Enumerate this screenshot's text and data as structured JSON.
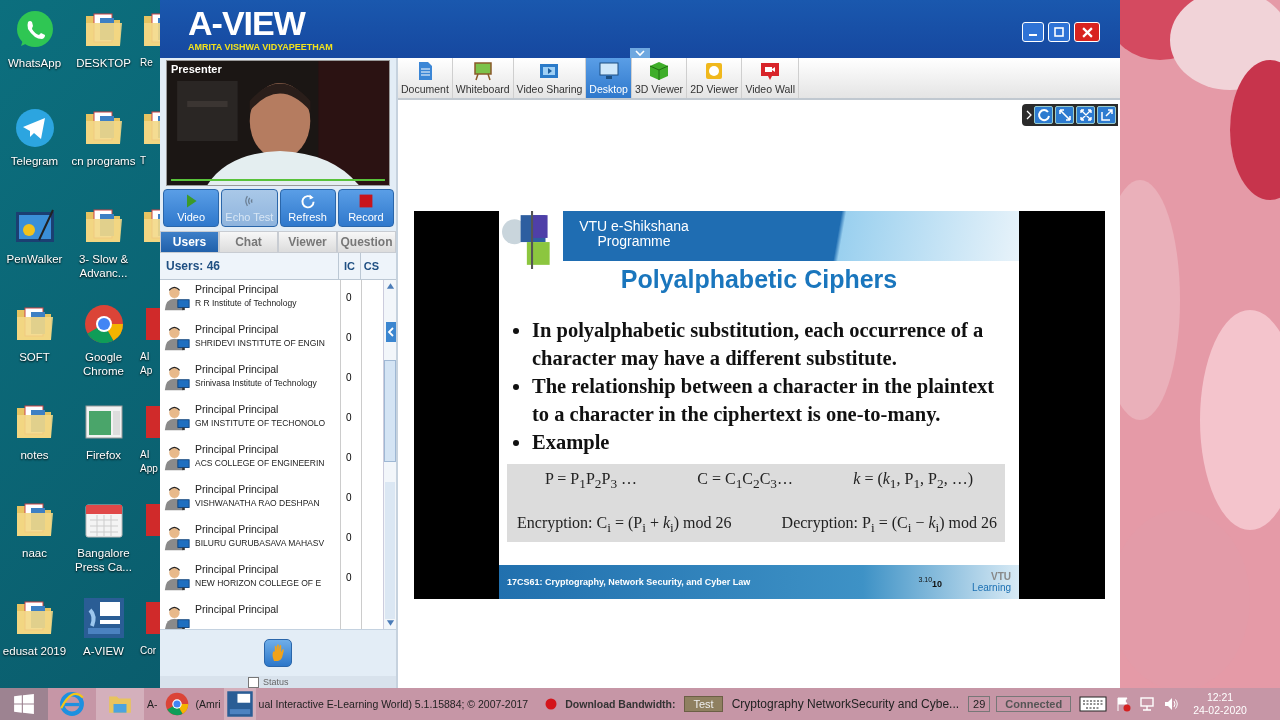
{
  "desktop": {
    "columns": [
      [
        {
          "kind": "whatsapp",
          "label": "WhatsApp"
        },
        {
          "kind": "telegram",
          "label": "Telegram"
        },
        {
          "kind": "painting",
          "label": "PenWalker"
        },
        {
          "kind": "folder",
          "label": "SOFT"
        },
        {
          "kind": "folder",
          "label": "notes"
        },
        {
          "kind": "folder",
          "label": "naac"
        },
        {
          "kind": "folder",
          "label": "edusat 2019"
        }
      ],
      [
        {
          "kind": "folder",
          "label": "DESKTOP"
        },
        {
          "kind": "folder",
          "label": "cn programs"
        },
        {
          "kind": "folder",
          "label": "3- Slow & Advanc..."
        },
        {
          "kind": "chrome",
          "label": "Google Chrome"
        },
        {
          "kind": "window",
          "label": "Firefox"
        },
        {
          "kind": "calendar",
          "label": "Bangalore Press Ca..."
        },
        {
          "kind": "aview",
          "label": "A-VIEW"
        }
      ],
      [
        {
          "kind": "folder",
          "label": "Re"
        },
        {
          "kind": "folder",
          "label": "T"
        },
        {
          "kind": "folder"
        },
        {
          "kind": "app",
          "label": "AI Ap"
        },
        {
          "kind": "app",
          "label": "AI App"
        },
        {
          "kind": "app"
        },
        {
          "kind": "app",
          "label": "Cor"
        }
      ]
    ]
  },
  "app": {
    "logo": "A-VIEW",
    "subtitle": "AMRITA VISHWA VIDYAPEETHAM"
  },
  "presenter": {
    "label": "Presenter"
  },
  "controls": [
    {
      "kind": "video",
      "label": "Video",
      "disabled": false
    },
    {
      "kind": "echo",
      "label": "Echo Test",
      "disabled": true
    },
    {
      "kind": "refresh",
      "label": "Refresh",
      "disabled": false
    },
    {
      "kind": "record",
      "label": "Record",
      "disabled": false
    }
  ],
  "panel_tabs": [
    {
      "label": "Users",
      "selected": true
    },
    {
      "label": "Chat",
      "selected": false
    },
    {
      "label": "Viewer",
      "selected": false
    },
    {
      "label": "Question",
      "selected": false
    }
  ],
  "users_header": {
    "count": "Users: 46",
    "columns": [
      "IC",
      "CS"
    ]
  },
  "users": [
    {
      "name": "Principal Principal",
      "institute": "R R Institute of Technology",
      "ic": "0"
    },
    {
      "name": "Principal Principal",
      "institute": "SHRIDEVI INSTITUTE OF ENGIN",
      "ic": "0"
    },
    {
      "name": "Principal Principal",
      "institute": "Srinivasa Institute of Technology",
      "ic": "0"
    },
    {
      "name": "Principal Principal",
      "institute": "GM INSTITUTE OF TECHONOLO",
      "ic": "0"
    },
    {
      "name": "Principal Principal",
      "institute": "ACS COLLEGE OF ENGINEERIN",
      "ic": "0"
    },
    {
      "name": "Principal Principal",
      "institute": "VISHWANATHA  RAO DESHPAN",
      "ic": "0"
    },
    {
      "name": "Principal Principal",
      "institute": "BILURU GURUBASAVA MAHASV",
      "ic": "0"
    },
    {
      "name": "Principal Principal",
      "institute": "NEW HORIZON COLLEGE OF E",
      "ic": "0"
    },
    {
      "name": "Principal Principal"
    }
  ],
  "status_option": {
    "label": "Status",
    "checked": false
  },
  "tools": [
    {
      "kind": "document",
      "label": "Document",
      "selected": false
    },
    {
      "kind": "whiteboard",
      "label": "Whiteboard",
      "selected": false
    },
    {
      "kind": "film",
      "label": "Video Sharing",
      "selected": false
    },
    {
      "kind": "desktop",
      "label": "Desktop",
      "selected": true
    },
    {
      "kind": "cube",
      "label": "3D Viewer",
      "selected": false
    },
    {
      "kind": "flat",
      "label": "2D Viewer",
      "selected": false
    },
    {
      "kind": "camera",
      "label": "Video Wall",
      "selected": false
    }
  ],
  "slide": {
    "banner": "VTU e-Shikshana Programme",
    "title": "Polyalphabetic Ciphers",
    "bullets": [
      "In polyalphabetic substitution, each occurrence of a character may have a different substitute.",
      "The relationship between a character in the plaintext to a character in the ciphertext is one-to-many.",
      "Example"
    ],
    "formulas_top": [
      "P = P$_{1}$P$_{2}$P$_{3}$ …",
      "C = C$_{1}$C$_{2}$C$_{3}$…",
      "*k* = (*k*$_{1}$, P$_{1}$, P$_{2}$, …)"
    ],
    "formulas_bottom": [
      "Encryption: C$_{i}$ = (P$_{i}$ + *k*$_{i}$) mod 26",
      "Decryption: P$_{i}$ = (C$_{i}$ − *k*$_{i}$) mod 26"
    ],
    "footer": "17CS61: Cryptography, Network Security, and Cyber Law",
    "section": "3.10",
    "page": "10",
    "brand_top": "VTU",
    "brand_bottom": "Learning"
  },
  "status_bar": {
    "app_prefix": "A-",
    "app_partial": "(Amri",
    "app_name": "ual Interactive E-Learning World) 5.1.15884; © 2007-2017",
    "bandwidth_label": "Download Bandwidth:",
    "test_button": "Test",
    "session": "Cryptography NetworkSecurity and Cybe...",
    "count": "29",
    "connection": "Connected"
  },
  "clock": {
    "time": "12:21",
    "date": "24-02-2020"
  }
}
